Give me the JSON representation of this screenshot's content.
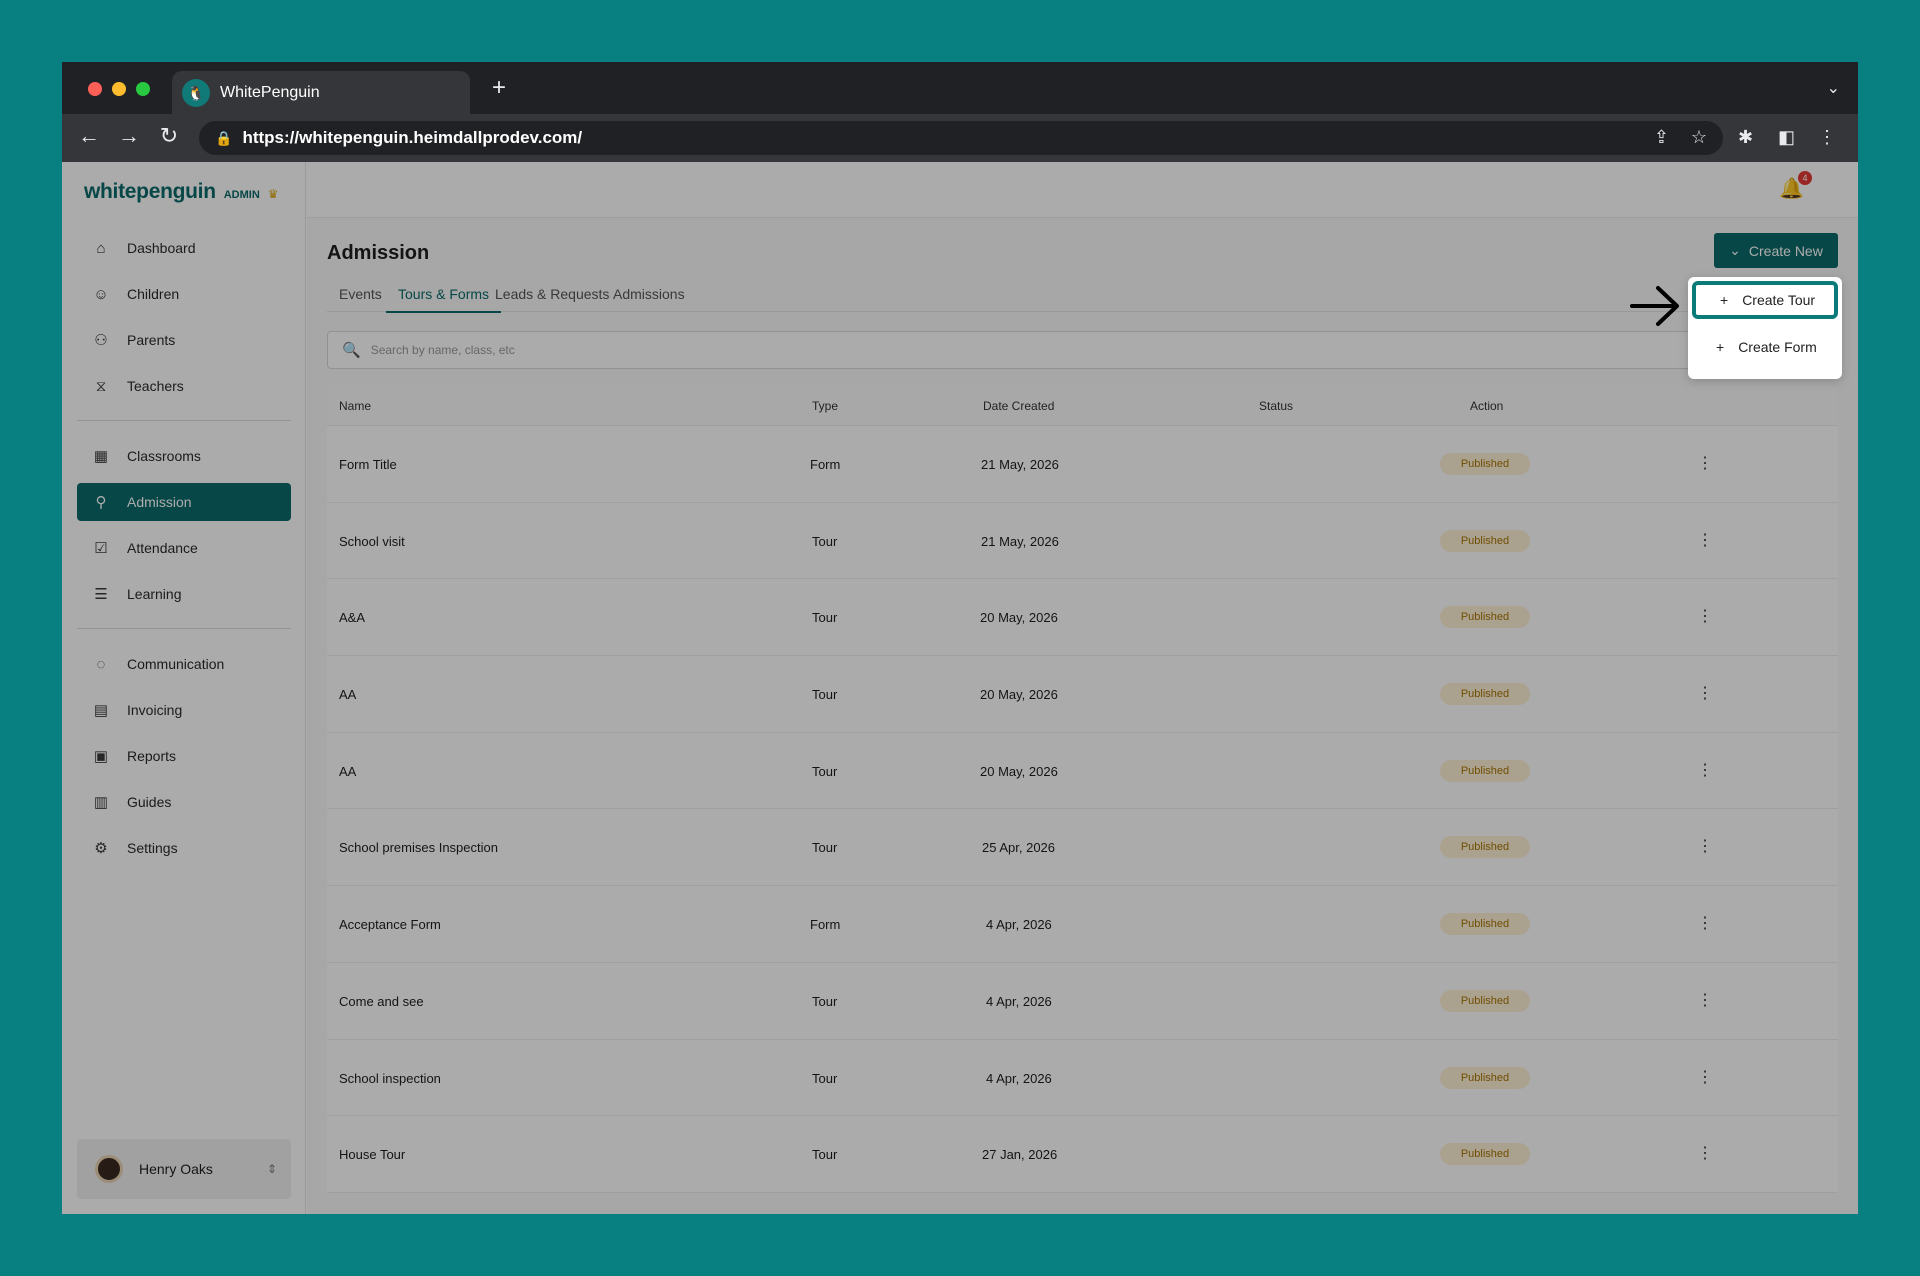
{
  "browser": {
    "tab_title": "WhitePenguin",
    "url": "https://whitepenguin.heimdallprodev.com/",
    "new_tab_symbol": "+"
  },
  "brand": {
    "name": "whitepenguin",
    "role": "ADMIN"
  },
  "sidebar": {
    "items": [
      {
        "label": "Dashboard",
        "icon": "home-icon"
      },
      {
        "label": "Children",
        "icon": "child-icon"
      },
      {
        "label": "Parents",
        "icon": "parents-icon"
      },
      {
        "label": "Teachers",
        "icon": "teacher-icon"
      },
      {
        "label": "Classrooms",
        "icon": "grid-icon"
      },
      {
        "label": "Admission",
        "icon": "admission-icon",
        "active": true
      },
      {
        "label": "Attendance",
        "icon": "check-icon"
      },
      {
        "label": "Learning",
        "icon": "learning-icon"
      },
      {
        "label": "Communication",
        "icon": "chat-icon"
      },
      {
        "label": "Invoicing",
        "icon": "invoice-icon"
      },
      {
        "label": "Reports",
        "icon": "reports-icon"
      },
      {
        "label": "Guides",
        "icon": "guides-icon"
      },
      {
        "label": "Settings",
        "icon": "gear-icon"
      }
    ],
    "user": {
      "name": "Henry Oaks"
    }
  },
  "notifications": {
    "count": "4"
  },
  "page": {
    "title": "Admission",
    "create_new_label": "Create New",
    "tabs": [
      "Events",
      "Tours & Forms",
      "Leads & Requests",
      "Admissions"
    ],
    "active_tab": "Tours & Forms",
    "search_placeholder": "Search by name, class, etc"
  },
  "dropdown": {
    "items": [
      "Create Tour",
      "Create Form"
    ],
    "highlighted": "Create Tour"
  },
  "table": {
    "columns": [
      "Name",
      "Type",
      "Date Created",
      "Status",
      "Action"
    ],
    "rows": [
      {
        "name": "Form Title",
        "type": "Form",
        "date": "21 May, 2026",
        "status": "Published"
      },
      {
        "name": "School visit",
        "type": "Tour",
        "date": "21 May, 2026",
        "status": "Published"
      },
      {
        "name": "A&A",
        "type": "Tour",
        "date": "20 May, 2026",
        "status": "Published"
      },
      {
        "name": "AA",
        "type": "Tour",
        "date": "20 May, 2026",
        "status": "Published"
      },
      {
        "name": "AA",
        "type": "Tour",
        "date": "20 May, 2026",
        "status": "Published"
      },
      {
        "name": "School premises Inspection",
        "type": "Tour",
        "date": "25 Apr, 2026",
        "status": "Published"
      },
      {
        "name": "Acceptance Form",
        "type": "Form",
        "date": "4 Apr, 2026",
        "status": "Published"
      },
      {
        "name": "Come and see",
        "type": "Tour",
        "date": "4 Apr, 2026",
        "status": "Published"
      },
      {
        "name": "School inspection",
        "type": "Tour",
        "date": "4 Apr, 2026",
        "status": "Published"
      },
      {
        "name": "House Tour",
        "type": "Tour",
        "date": "27 Jan, 2026",
        "status": "Published"
      }
    ]
  },
  "colors": {
    "background": "#087f80",
    "accent": "#0b6b6a",
    "badge_bg": "#fff1d6",
    "badge_text": "#a87500"
  }
}
